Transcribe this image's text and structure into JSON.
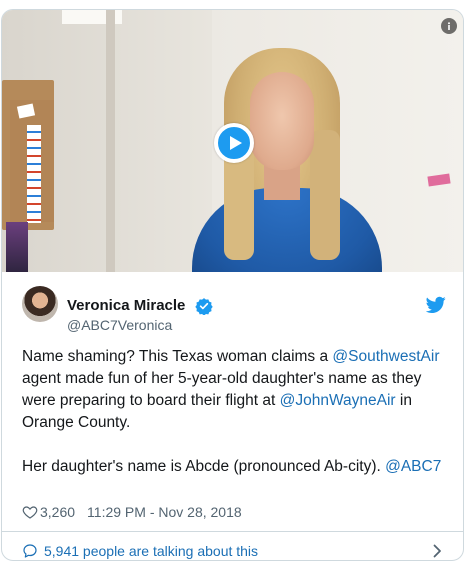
{
  "video": {
    "play_icon": "play-icon",
    "info_icon": "info-icon"
  },
  "tweet": {
    "author": {
      "display_name": "Veronica Miracle",
      "handle": "@ABC7Veronica",
      "verified_icon": "verified-badge-icon"
    },
    "platform_icon": "twitter-bird-icon",
    "body": {
      "p1_t1": "Name shaming? This Texas woman claims a ",
      "p1_link1": "@SouthwestAir",
      "p1_t2": " agent made fun of her 5-year-old daughter's name as they were preparing to board their flight at ",
      "p1_link2": "@JohnWayneAir",
      "p1_t3": " in Orange County.",
      "p2_t1": "Her daughter's name is Abcde (pronounced Ab-city). ",
      "p2_link1": "@ABC7"
    },
    "likes": "3,260",
    "timestamp": "11:29 PM - Nov 28, 2018",
    "talking": "5,941 people are talking about this"
  },
  "colors": {
    "accent": "#1d9bf0",
    "link": "#1b6fb5",
    "muted": "#536471",
    "border": "#cfd9de"
  }
}
